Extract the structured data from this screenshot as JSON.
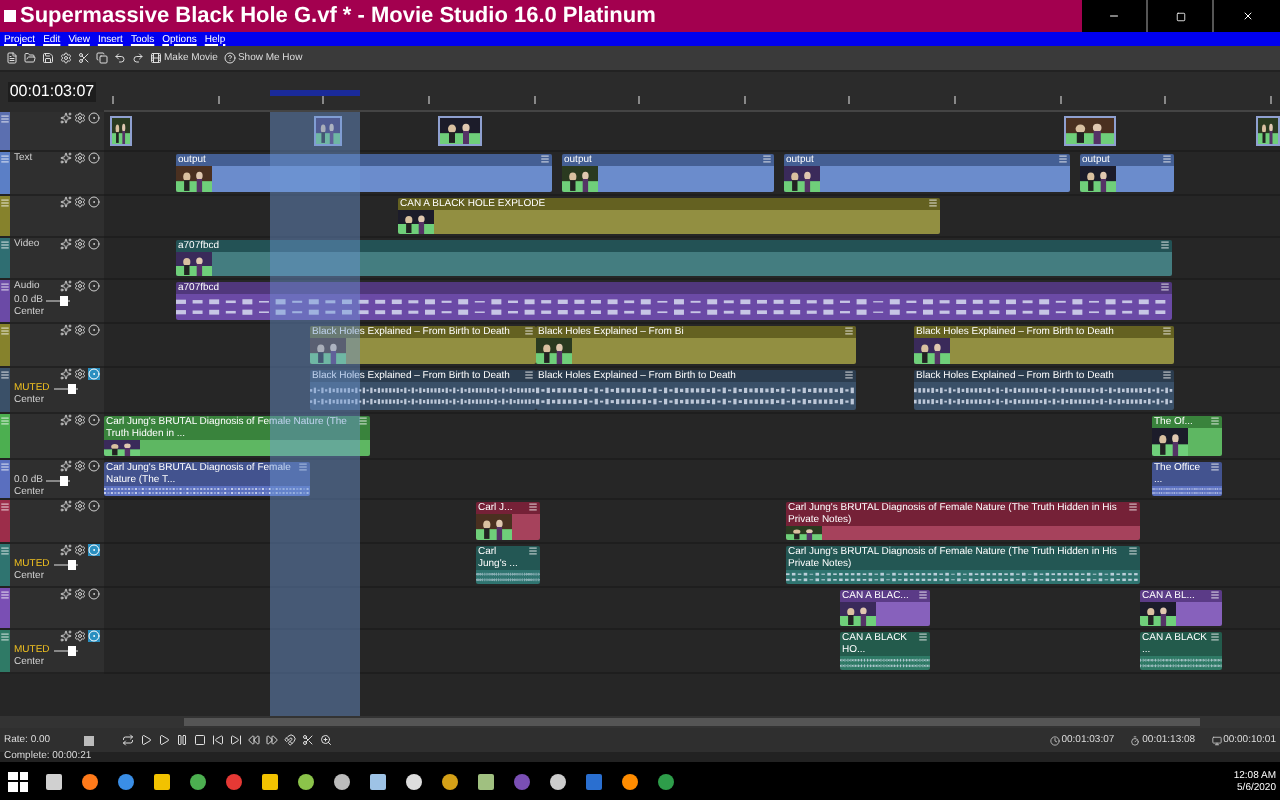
{
  "window": {
    "title": "Supermassive Black Hole G.vf * - Movie Studio 16.0 Platinum"
  },
  "menu": [
    "Project",
    "Edit",
    "View",
    "Insert",
    "Tools",
    "Options",
    "Help"
  ],
  "toolbar": {
    "buttons": [
      "Make Movie",
      "Show Me How"
    ]
  },
  "timecode": "00:01:03:07",
  "tracks": [
    {
      "kind": "video",
      "color": "#5b6fb0",
      "clips": [
        {
          "kind": "thumbnail"
        },
        {
          "kind": "thumbnail"
        },
        {
          "kind": "thumbnail"
        },
        {
          "kind": "thumbnail"
        },
        {
          "kind": "thumbnail"
        }
      ]
    },
    {
      "kind": "video",
      "name": "Text",
      "color": "#5b7fc6",
      "clips": [
        {
          "kind": "clip",
          "title": "output"
        },
        {
          "kind": "clip",
          "title": "output"
        },
        {
          "kind": "clip",
          "title": "output"
        },
        {
          "kind": "clip",
          "title": "output"
        }
      ]
    },
    {
      "kind": "video",
      "color": "#86822c",
      "clips": [
        {
          "kind": "clip",
          "title": "CAN A BLACK HOLE EXPLODE"
        }
      ]
    },
    {
      "kind": "video",
      "name": "Video",
      "color": "#2f6e72",
      "clips": [
        {
          "kind": "clip",
          "title": "a707fbcd"
        }
      ]
    },
    {
      "kind": "audio",
      "name": "Audio",
      "color": "#6b4aa6",
      "volume": "0.0 dB",
      "muted": false,
      "level": 0.75,
      "pan": "Center",
      "clips": [
        {
          "kind": "clip",
          "title": "a707fbcd"
        }
      ]
    },
    {
      "kind": "video",
      "color": "#86822c",
      "clips": [
        {
          "kind": "clip",
          "title": "Black Holes Explained – From Birth to Death"
        },
        {
          "kind": "clip",
          "title": "Black Holes Explained – From Bi"
        },
        {
          "kind": "clip",
          "title": "Black Holes Explained – From Birth to Death"
        }
      ]
    },
    {
      "kind": "audio",
      "color": "#3a5068",
      "volume": "MUTED",
      "muted": true,
      "level": 0.75,
      "pan": "Center",
      "clips": [
        {
          "kind": "clip",
          "title": "Black Holes Explained – From Birth to Death"
        },
        {
          "kind": "clip",
          "title": "Black Holes Explained – From Birth to Death"
        },
        {
          "kind": "clip",
          "title": "Black Holes Explained – From Birth to Death"
        }
      ]
    },
    {
      "kind": "video",
      "color": "#4caf50",
      "clips": [
        {
          "kind": "clip",
          "title": "Carl Jung's BRUTAL Diagnosis of Female Nature (The Truth Hidden in ..."
        },
        {
          "kind": "clip",
          "title": "The Of..."
        }
      ]
    },
    {
      "kind": "audio",
      "color": "#5a6fbf",
      "volume": "0.0 dB",
      "muted": false,
      "level": 0.75,
      "pan": "Center",
      "clips": [
        {
          "kind": "clip",
          "title": "Carl Jung's BRUTAL Diagnosis of Female Nature (The T..."
        },
        {
          "kind": "clip",
          "title": "The Office ..."
        }
      ]
    },
    {
      "kind": "video",
      "color": "#9c2d4a",
      "clips": [
        {
          "kind": "clip",
          "title": "Carl J..."
        },
        {
          "kind": "clip",
          "title": "Carl Jung's BRUTAL Diagnosis of Female Nature (The Truth Hidden in His Private Notes)"
        }
      ]
    },
    {
      "kind": "audio",
      "color": "#2f7470",
      "volume": "MUTED",
      "muted": true,
      "level": 0.75,
      "pan": "Center",
      "clips": [
        {
          "kind": "clip",
          "title": "Carl Jung's ..."
        },
        {
          "kind": "clip",
          "title": "Carl Jung's BRUTAL Diagnosis of Female Nature (The Truth Hidden in His Private Notes)"
        }
      ]
    },
    {
      "kind": "video",
      "color": "#7a4fb4",
      "clips": [
        {
          "kind": "clip",
          "title": "CAN A BLAC..."
        },
        {
          "kind": "clip",
          "title": "CAN A BL..."
        }
      ]
    },
    {
      "kind": "audio",
      "color": "#2f7a66",
      "volume": "MUTED",
      "muted": true,
      "level": 0.75,
      "pan": "Center",
      "clips": [
        {
          "kind": "clip",
          "title": "CAN A BLACK HO..."
        },
        {
          "kind": "clip",
          "title": "CAN A BLACK ..."
        }
      ]
    }
  ],
  "transport": {
    "rate": "Rate: 0.00",
    "times": [
      "00:01:03:07",
      "00:01:13:08",
      "00:00:10:01"
    ]
  },
  "status": "Complete: 00:00:21",
  "taskbar": {
    "time": "12:08 AM",
    "date": "5/6/2020"
  }
}
